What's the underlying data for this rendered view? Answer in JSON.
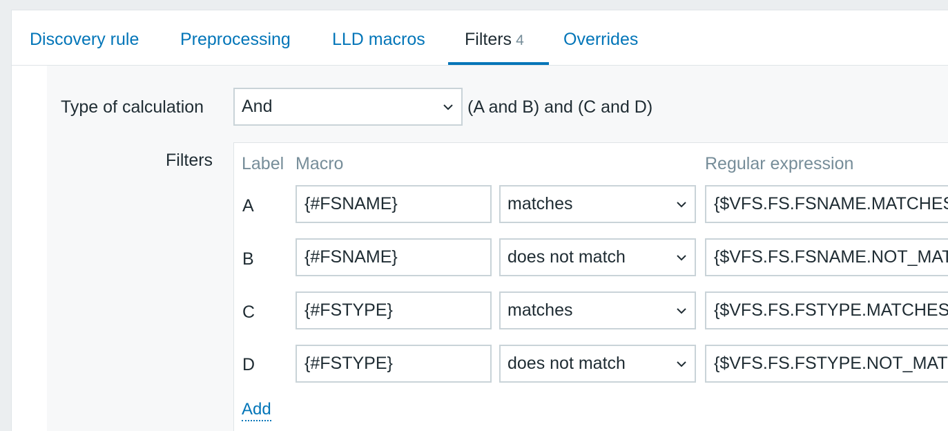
{
  "tabs": [
    {
      "label": "Discovery rule"
    },
    {
      "label": "Preprocessing"
    },
    {
      "label": "LLD macros"
    },
    {
      "label": "Filters",
      "count": "4",
      "active": true
    },
    {
      "label": "Overrides"
    }
  ],
  "calculation": {
    "label": "Type of calculation",
    "value": "And",
    "formula": "(A and B) and (C and D)"
  },
  "filters": {
    "label": "Filters",
    "headers": {
      "label": "Label",
      "macro": "Macro",
      "regex": "Regular expression"
    },
    "rows": [
      {
        "label": "A",
        "macro": "{#FSNAME}",
        "operator": "matches",
        "regex": "{$VFS.FS.FSNAME.MATCHES}"
      },
      {
        "label": "B",
        "macro": "{#FSNAME}",
        "operator": "does not match",
        "regex": "{$VFS.FS.FSNAME.NOT_MATCHES}"
      },
      {
        "label": "C",
        "macro": "{#FSTYPE}",
        "operator": "matches",
        "regex": "{$VFS.FS.FSTYPE.MATCHES}"
      },
      {
        "label": "D",
        "macro": "{#FSTYPE}",
        "operator": "does not match",
        "regex": "{$VFS.FS.FSTYPE.NOT_MATCHES}"
      }
    ],
    "add_label": "Add"
  },
  "icons": {
    "dropdown": "chevron-down-icon"
  },
  "colors": {
    "link": "#0275b8",
    "text": "#1f2c33",
    "muted": "#768d99",
    "border": "#c9d3d8"
  }
}
